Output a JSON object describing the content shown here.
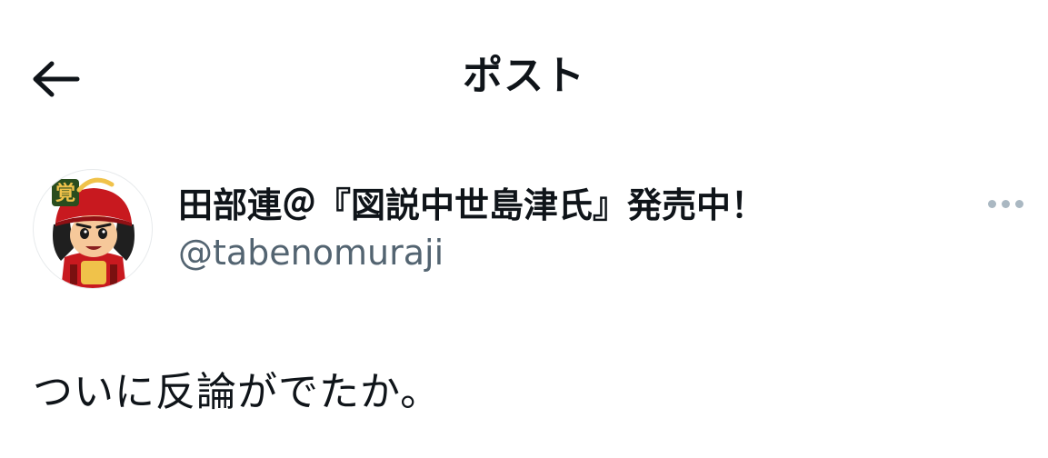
{
  "header": {
    "title": "ポスト",
    "back_icon": "arrow-left-icon"
  },
  "author": {
    "display_name": "田部連＠『図説中世島津氏』発売中！",
    "handle": "@tabenomuraji",
    "avatar_icon": "samurai-avatar",
    "more_icon": "more-horizontal-icon"
  },
  "post": {
    "text": "ついに反論がでたか。"
  }
}
